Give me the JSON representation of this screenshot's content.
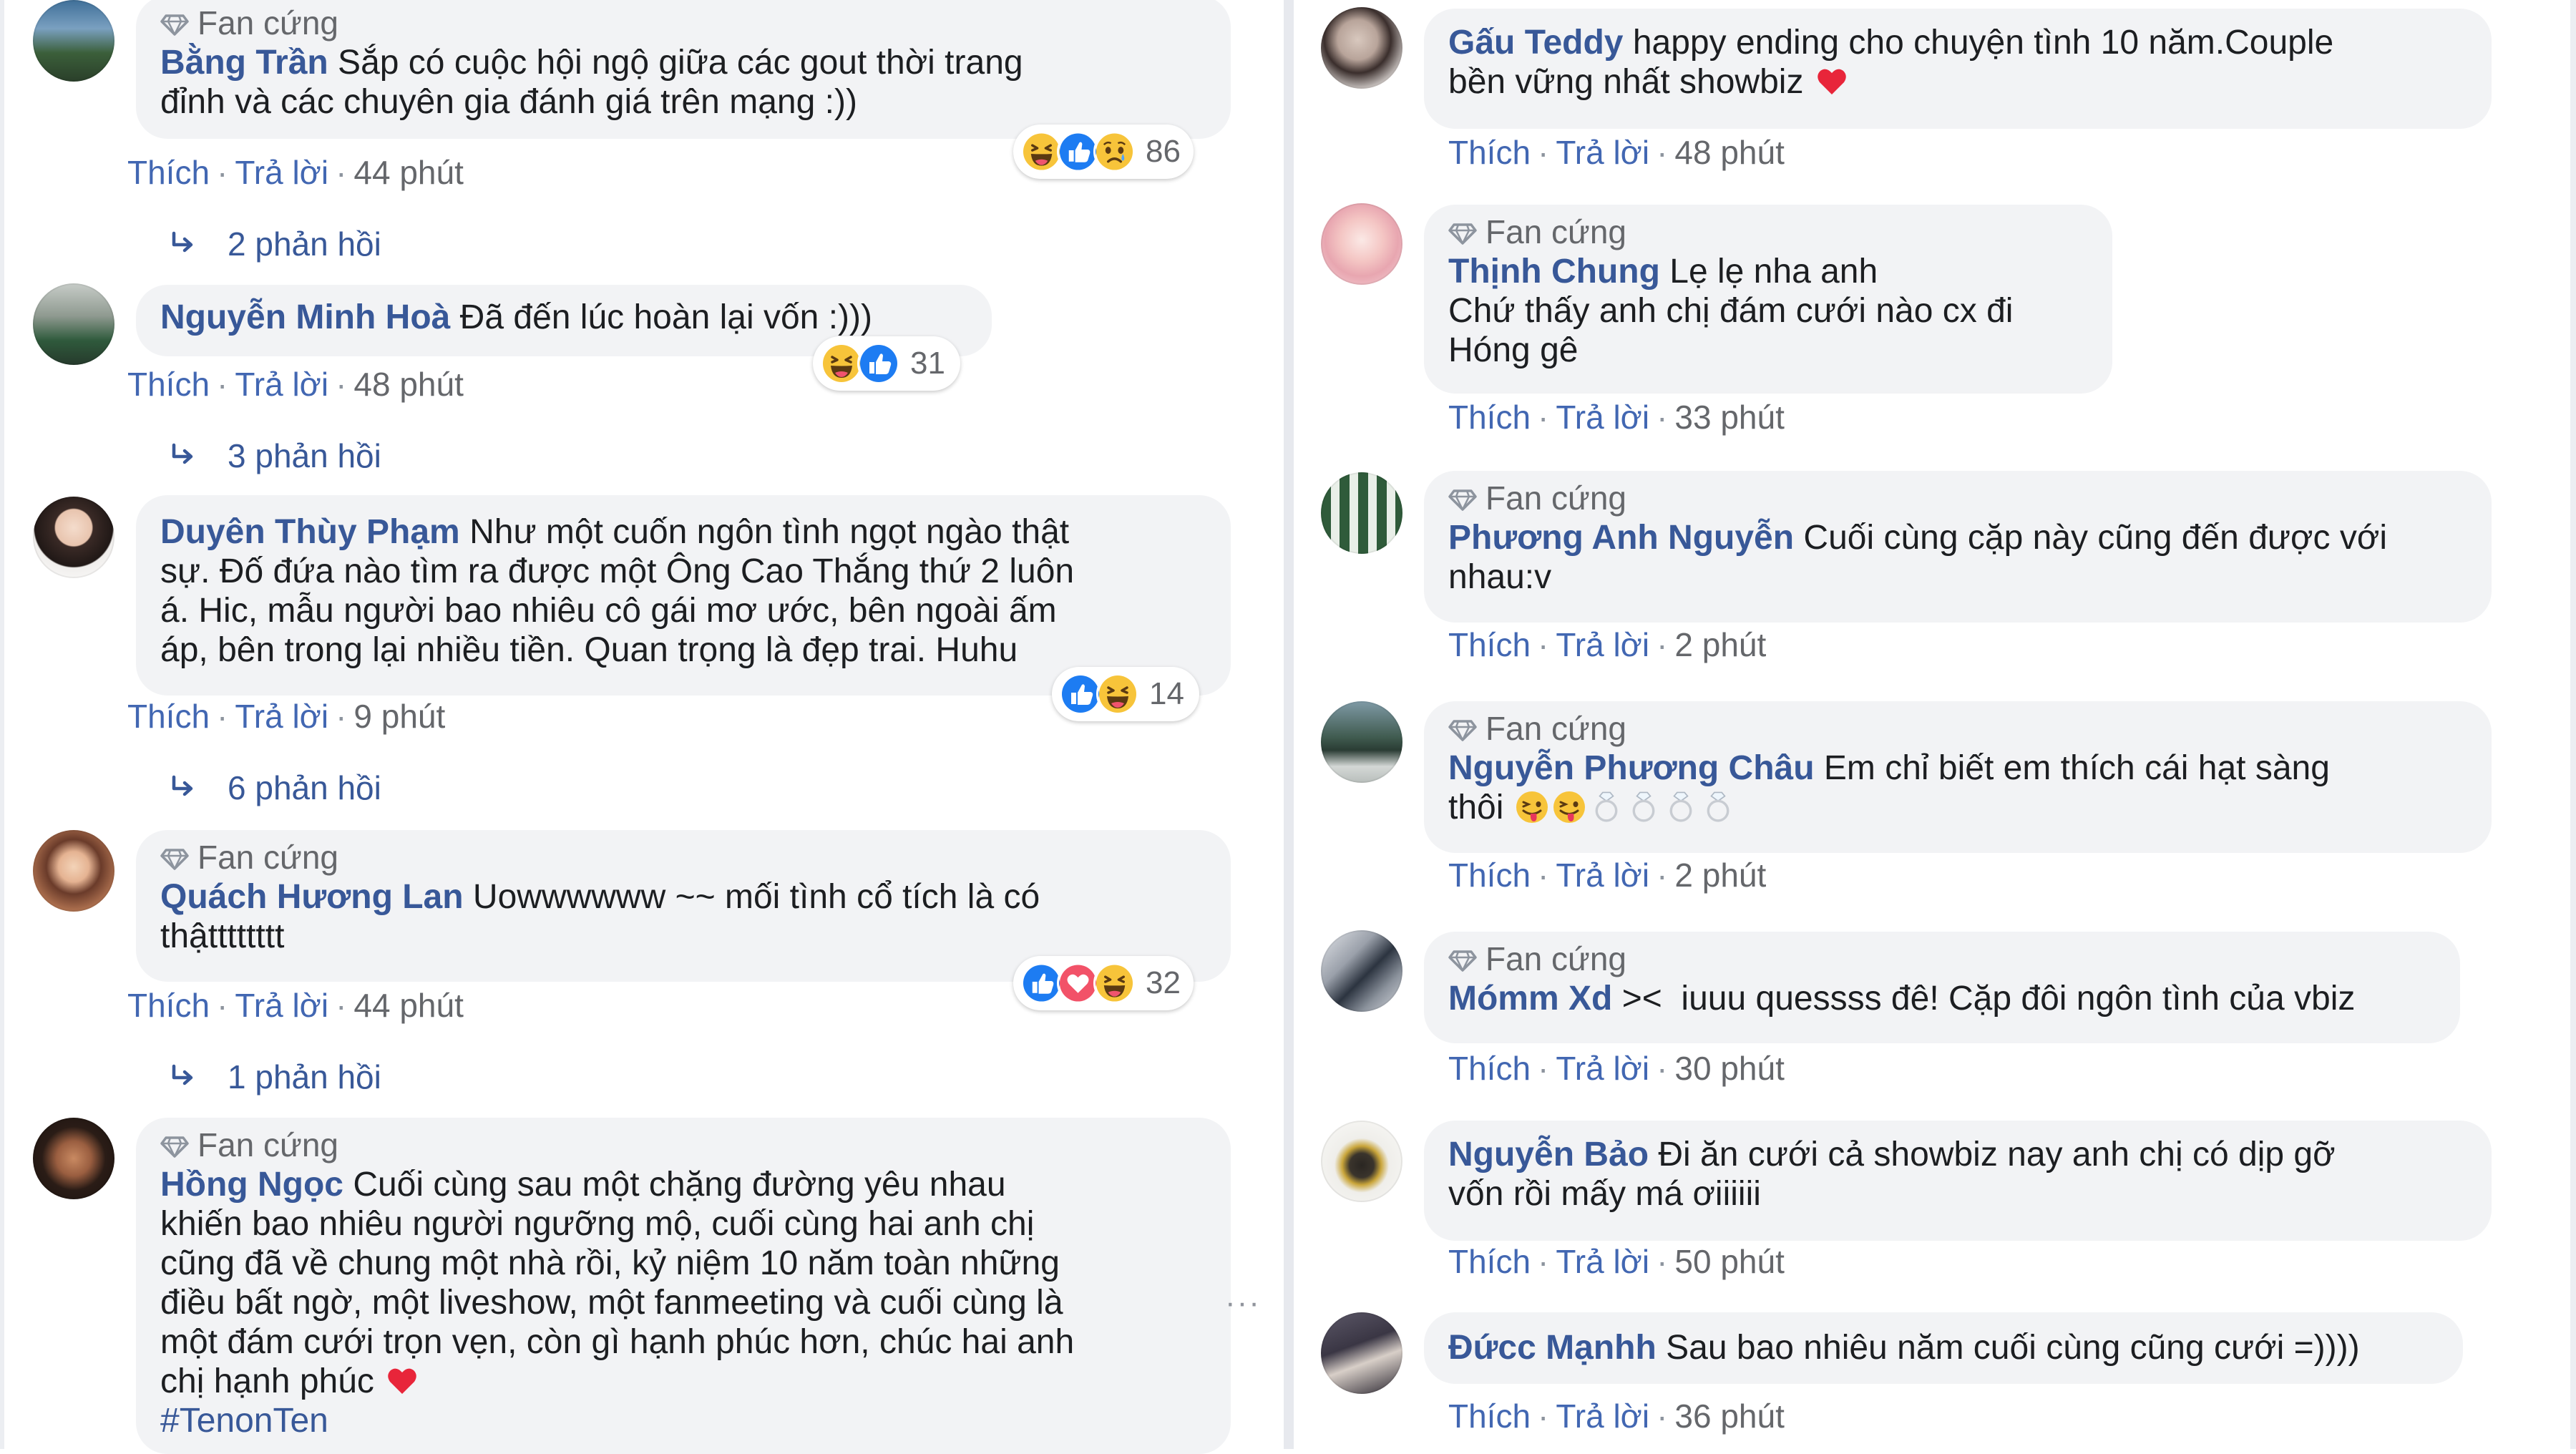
{
  "colors": {
    "link": "#385898",
    "action": "#4267b2",
    "meta": "#65676b",
    "bubble": "#f2f3f5",
    "heart": "#e8253a"
  },
  "left_comments": [
    {
      "badge": "Fan cứng",
      "author": "Bằng Trần",
      "text": "Sắp có cuộc hội ngộ giữa các gout thời trang\nđỉnh và các chuyên gia đánh giá trên mạng :))",
      "like": "Thích",
      "reply": "Trả lời",
      "time": "44 phút",
      "reaction_count": "86",
      "reactions": [
        "haha-icon",
        "like-icon",
        "sad-icon"
      ],
      "replies": "2 phản hồi"
    },
    {
      "badge": "",
      "author": "Nguyễn Minh Hoà",
      "text": "Đã đến lúc hoàn lại vốn :)))",
      "like": "Thích",
      "reply": "Trả lời",
      "time": "48 phút",
      "reaction_count": "31",
      "reactions": [
        "haha-icon",
        "like-icon"
      ],
      "replies": "3 phản hồi"
    },
    {
      "badge": "",
      "author": "Duyên Thùy Phạm",
      "text": "Như một cuốn ngôn tình ngọt ngào thật\nsự. Đố đứa nào tìm ra được một Ông Cao Thắng thứ 2 luôn\ná. Hic, mẫu người bao nhiêu cô gái mơ ước, bên ngoài ấm\náp, bên trong lại nhiều tiền. Quan trọng là đẹp trai. Huhu",
      "like": "Thích",
      "reply": "Trả lời",
      "time": "9 phút",
      "reaction_count": "14",
      "reactions": [
        "like-icon",
        "haha-icon"
      ],
      "replies": "6 phản hồi"
    },
    {
      "badge": "Fan cứng",
      "author": "Quách Hương Lan",
      "text": "Uowwwwww ~~ mối tình cổ tích là có\nthậtttttttt",
      "like": "Thích",
      "reply": "Trả lời",
      "time": "44 phút",
      "reaction_count": "32",
      "reactions": [
        "like-icon",
        "love-icon",
        "haha-icon"
      ],
      "replies": "1 phản hồi"
    },
    {
      "badge": "Fan cứng",
      "author": "Hồng Ngọc",
      "text": "Cuối cùng sau một chặng đường yêu nhau\nkhiến bao nhiêu người ngưỡng mộ, cuối cùng hai anh chị\ncũng đã về chung một nhà rồi, kỷ niệm 10 năm toàn những\nđiều bất ngờ, một liveshow, một fanmeeting và cuối cùng là\nmột đám cưới trọn vẹn, còn gì hạnh phúc hơn, chúc hai anh\nchị hạnh phúc",
      "hashtag": "#TenonTen"
    }
  ],
  "right_comments": [
    {
      "badge": "",
      "author": "Gấu Teddy",
      "text": "happy ending cho chuyện tình 10 năm.Couple\nbền vững nhất showbiz",
      "like": "Thích",
      "reply": "Trả lời",
      "time": "48 phút"
    },
    {
      "badge": "Fan cứng",
      "author": "Thịnh Chung",
      "text": "Lẹ lẹ nha anh\nChứ thấy anh chị đám cưới nào cx đi\nHóng gê",
      "like": "Thích",
      "reply": "Trả lời",
      "time": "33 phút"
    },
    {
      "badge": "Fan cứng",
      "author": "Phương Anh Nguyễn",
      "text": "Cuối cùng cặp này cũng đến được với\nnhau:v",
      "like": "Thích",
      "reply": "Trả lời",
      "time": "2 phút"
    },
    {
      "badge": "Fan cứng",
      "author": "Nguyễn Phương Châu",
      "text": "Em chỉ biết em thích cái hạt sàng\nthôi",
      "like": "Thích",
      "reply": "Trả lời",
      "time": "2 phút"
    },
    {
      "badge": "Fan cứng",
      "author": "Mómm Xd",
      "text": "><  iuuu quessss đê! Cặp đôi ngôn tình của vbiz",
      "like": "Thích",
      "reply": "Trả lời",
      "time": "30 phút"
    },
    {
      "badge": "",
      "author": "Nguyễn Bảo",
      "text": "Đi ăn cưới cả showbiz nay anh chị có dịp gỡ\nvốn rồi mấy má ơiiiiii",
      "like": "Thích",
      "reply": "Trả lời",
      "time": "50 phút"
    },
    {
      "badge": "",
      "author": "Đứcc Mạnhh",
      "text": "Sau bao nhiêu năm cuối cùng cũng cưới =))))",
      "like": "Thích",
      "reply": "Trả lời",
      "time": "36 phút"
    }
  ],
  "more_dots": "···"
}
